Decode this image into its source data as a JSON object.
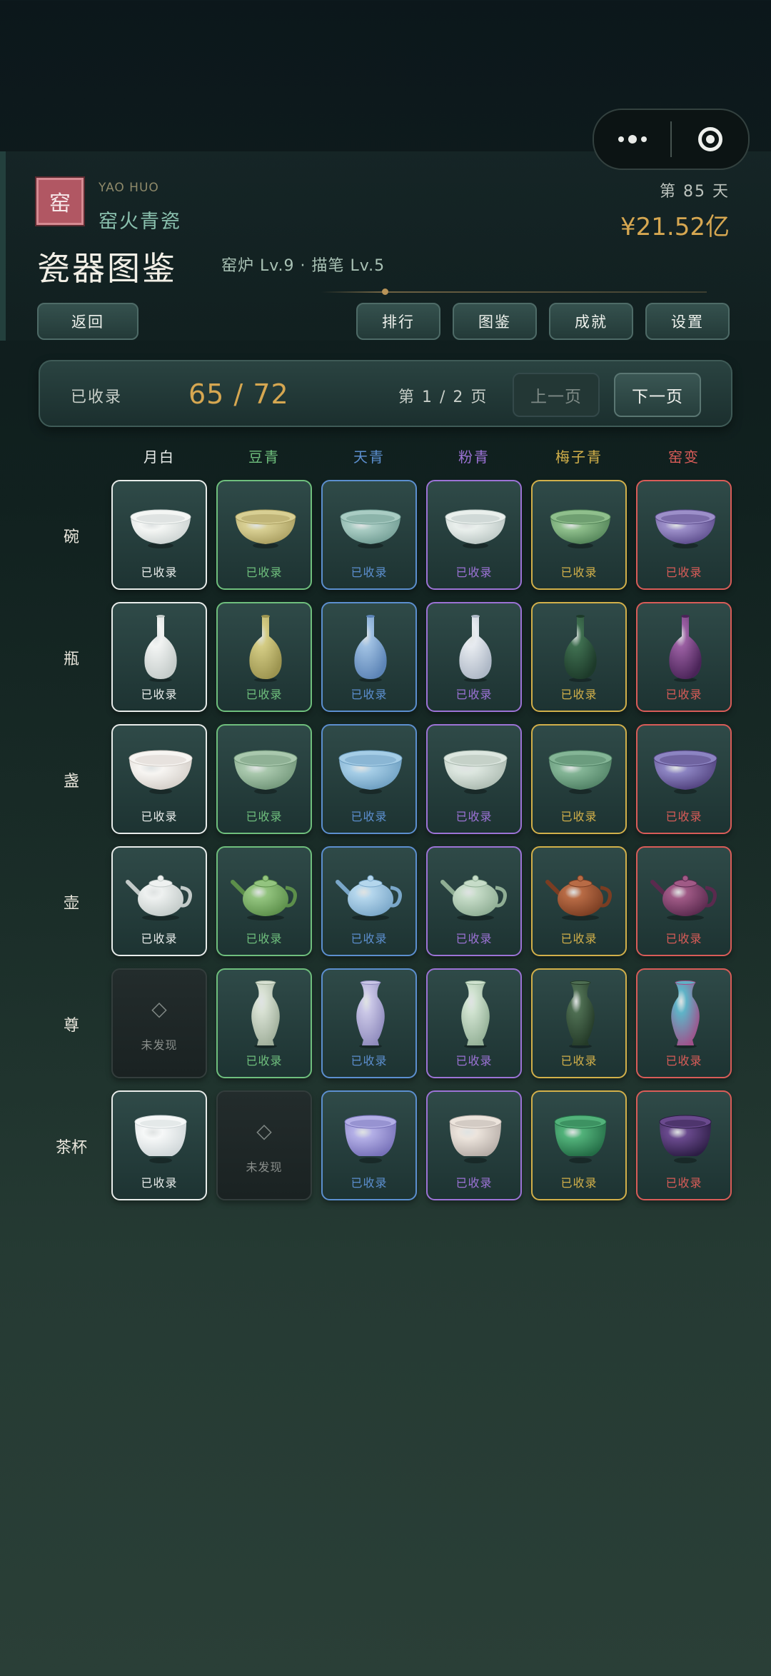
{
  "capsule": {
    "more_icon": "more-dots-icon",
    "close_icon": "target-ring-icon"
  },
  "brand": {
    "logo_char": "窑",
    "name_en": "YAO HUO",
    "name_cn": "窑火青瓷"
  },
  "status": {
    "day": "第 85 天",
    "money": "¥21.52亿"
  },
  "title": "瓷器图鉴",
  "levels": "窑炉 Lv.9 · 描笔 Lv.5",
  "nav": {
    "back": "返回",
    "rank": "排行",
    "codex": "图鉴",
    "achievement": "成就",
    "settings": "设置"
  },
  "stats": {
    "label": "已收录",
    "count": "65 / 72",
    "page": "第 1 / 2 页",
    "prev": "上一页",
    "next": "下一页"
  },
  "glazes": [
    {
      "name": "月白",
      "color": "#e8ecea"
    },
    {
      "name": "豆青",
      "color": "#6fbf7d"
    },
    {
      "name": "天青",
      "color": "#5c8fcf"
    },
    {
      "name": "粉青",
      "color": "#9c73d6"
    },
    {
      "name": "梅子青",
      "color": "#d2b04a"
    },
    {
      "name": "窑变",
      "color": "#d95c58"
    }
  ],
  "shapes": [
    "碗",
    "瓶",
    "盏",
    "壶",
    "尊",
    "茶杯"
  ],
  "labels": {
    "collected": "已收录",
    "undiscovered": "未发现",
    "undiscovered_glyph": "◇"
  },
  "grid": [
    [
      {
        "s": "c",
        "c1": "#f4f6f4",
        "c2": "#c9d0cf"
      },
      {
        "s": "c",
        "c1": "#d8cf93",
        "c2": "#a79c5e"
      },
      {
        "s": "c",
        "c1": "#a9ccc3",
        "c2": "#6f9b92"
      },
      {
        "s": "c",
        "c1": "#e9efec",
        "c2": "#b8c4c1"
      },
      {
        "s": "c",
        "c1": "#8fbf8c",
        "c2": "#4f8055"
      },
      {
        "s": "c",
        "c1": "#9c8fc9",
        "c2": "#5a4a8a"
      }
    ],
    [
      {
        "s": "c",
        "c1": "#f2f4f3",
        "c2": "#c5ccca"
      },
      {
        "s": "c",
        "c1": "#d4cc84",
        "c2": "#9c9450"
      },
      {
        "s": "c",
        "c1": "#9fc0e2",
        "c2": "#5c84b6"
      },
      {
        "s": "c",
        "c1": "#e7ebf0",
        "c2": "#aeb8c6"
      },
      {
        "s": "c",
        "c1": "#3f6f50",
        "c2": "#1d3a2a"
      },
      {
        "s": "c",
        "c1": "#9a5fa2",
        "c2": "#4a2458"
      }
    ],
    [
      {
        "s": "c",
        "c1": "#f7f5f2",
        "c2": "#d2ccc6"
      },
      {
        "s": "c",
        "c1": "#a9c8ad",
        "c2": "#6f9477"
      },
      {
        "s": "c",
        "c1": "#a5cde6",
        "c2": "#6a9cbf"
      },
      {
        "s": "c",
        "c1": "#dce6df",
        "c2": "#a9b8ae"
      },
      {
        "s": "c",
        "c1": "#84b596",
        "c2": "#4d7e62"
      },
      {
        "s": "c",
        "c1": "#8c84c2",
        "c2": "#4e3e7a"
      }
    ],
    [
      {
        "s": "c",
        "c1": "#eef1f0",
        "c2": "#c2cac8"
      },
      {
        "s": "c",
        "c1": "#93c47f",
        "c2": "#5c8f4a"
      },
      {
        "s": "c",
        "c1": "#b4d6ec",
        "c2": "#7aa7c9"
      },
      {
        "s": "c",
        "c1": "#c6dcc8",
        "c2": "#8fae94"
      },
      {
        "s": "c",
        "c1": "#b86b45",
        "c2": "#7a3d22"
      },
      {
        "s": "c",
        "c1": "#a05a86",
        "c2": "#5a2a4e"
      }
    ],
    [
      {
        "s": "u"
      },
      {
        "s": "c",
        "c1": "#d7e0d2",
        "c2": "#9fae9a"
      },
      {
        "s": "c",
        "c1": "#c9c6e6",
        "c2": "#8f8bbd"
      },
      {
        "s": "c",
        "c1": "#cfe2cf",
        "c2": "#93b096"
      },
      {
        "s": "c",
        "c1": "#4e6e52",
        "c2": "#243a28"
      },
      {
        "s": "c",
        "c1": "#5fb3c7",
        "c2": "#a0508a"
      }
    ],
    [
      {
        "s": "c",
        "c1": "#f6f8f8",
        "c2": "#cfd6d8"
      },
      {
        "s": "u"
      },
      {
        "s": "c",
        "c1": "#b3afe6",
        "c2": "#7670b8"
      },
      {
        "s": "c",
        "c1": "#ece4dc",
        "c2": "#b5aca6"
      },
      {
        "s": "c",
        "c1": "#52b27a",
        "c2": "#236b45"
      },
      {
        "s": "c",
        "c1": "#6a4a8e",
        "c2": "#2c1d44"
      }
    ]
  ]
}
